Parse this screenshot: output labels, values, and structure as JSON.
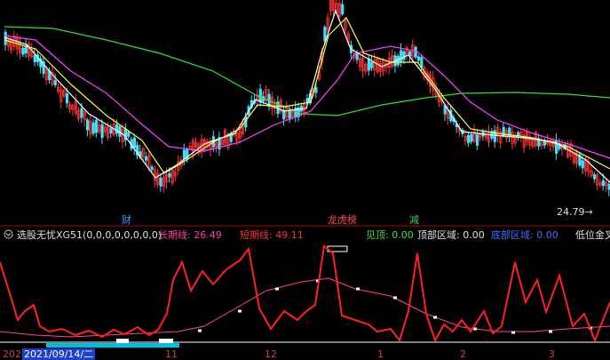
{
  "main_chart": {
    "price_label": "24.79",
    "arrow": "→",
    "events": [
      {
        "text": "财",
        "color": "#3aa0ff"
      },
      {
        "text": "龙虎榜",
        "color": "#ff5050"
      },
      {
        "text": "减",
        "color": "#40d060"
      }
    ]
  },
  "indicator": {
    "name": "选股无忧XG51(0,0,0,0,0,0,0,0)",
    "long_line": "长期线: 26.49",
    "short_line": "短期线: 49.11",
    "see_top": "见顶: 0.00",
    "top_area": "顶部区域: 0.00",
    "bottom_area": "底部区域: 0.00",
    "low_gold": "低位金叉"
  },
  "time_axis": {
    "ticks": [
      "202",
      "11",
      "12",
      "1",
      "2",
      "3"
    ],
    "cursor_date": "2021/09/14/二"
  },
  "colors": {
    "up": "#ff3333",
    "down": "#40e0ff",
    "ma5": "#ffffff",
    "ma10": "#ffff40",
    "ma20": "#ff40ff",
    "ma60": "#30e030",
    "long": "#ff40a0",
    "short": "#ff2020"
  }
}
